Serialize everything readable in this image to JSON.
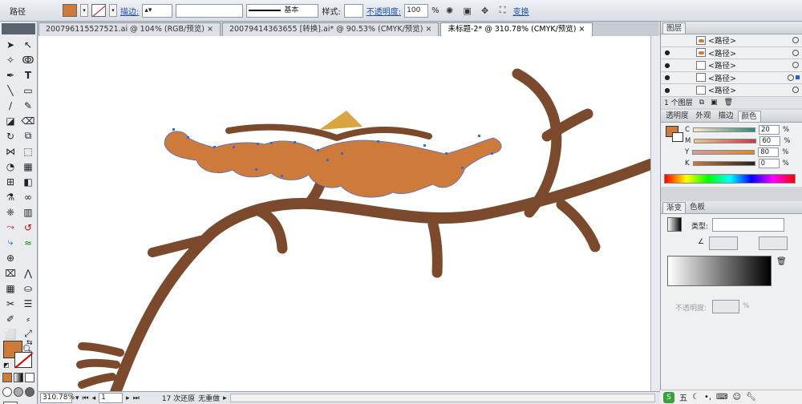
{
  "control_bar": {
    "object_type": "路径",
    "fill_color": "#cd7a3b",
    "stroke_label": "描边:",
    "stroke_preset": "基本",
    "style_label": "样式:",
    "opacity_label": "不透明度:",
    "opacity_value": "100",
    "opacity_unit": "%",
    "transform_label": "变换"
  },
  "tabs": [
    {
      "label": "200796115527521.ai @ 104% (RGB/预览)",
      "active": false
    },
    {
      "label": "2007941436365​5 [转换].ai* @ 90.53% (CMYK/预览)",
      "active": false
    },
    {
      "label": "未标题-2* @ 310.78% (CMYK/预览)",
      "active": true
    }
  ],
  "status": {
    "zoom": "310.78%",
    "page": "1",
    "undo": "17 次还原",
    "redo": "无重做"
  },
  "layers": {
    "tab": "图层",
    "rows": [
      "<路径>",
      "<路径>",
      "<路径>",
      "<路径>",
      "<路径>"
    ],
    "footer": "1 个图层"
  },
  "color_panel": {
    "tabs": [
      "透明度",
      "外观",
      "描边",
      "颜色"
    ],
    "channels": [
      {
        "label": "C",
        "value": "20",
        "unit": "%",
        "color": "#00a0c6"
      },
      {
        "label": "M",
        "value": "60",
        "unit": "%",
        "color": "#d4007a"
      },
      {
        "label": "Y",
        "value": "80",
        "unit": "%",
        "color": "#e8d000"
      },
      {
        "label": "K",
        "value": "0",
        "unit": "%",
        "color": "#222222"
      }
    ]
  },
  "gradient_panel": {
    "tabs": [
      "渐变",
      "色板"
    ],
    "type_label": "类型:",
    "opacity_label": "不透明度:",
    "opacity_unit": "%"
  },
  "colors": {
    "branch": "#7b4a2d",
    "flower": "#cd7a3b",
    "cap": "#d9a441",
    "anchor": "#3a6bd6"
  }
}
